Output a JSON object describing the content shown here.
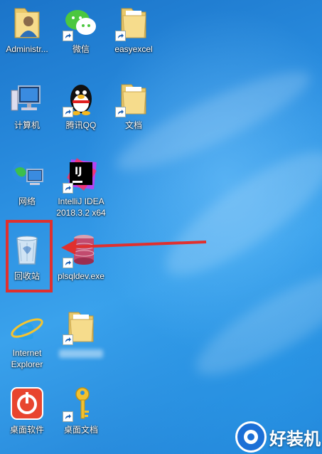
{
  "desktop": {
    "icons": [
      {
        "id": "administrator",
        "label": "Administr...",
        "icon": "user-folder-icon"
      },
      {
        "id": "wechat",
        "label": "微信",
        "icon": "wechat-icon"
      },
      {
        "id": "easyexcel",
        "label": "easyexcel",
        "icon": "folder-icon"
      },
      {
        "id": "computer",
        "label": "计算机",
        "icon": "computer-icon"
      },
      {
        "id": "qq",
        "label": "腾讯QQ",
        "icon": "qq-penguin-icon"
      },
      {
        "id": "documents",
        "label": "文档",
        "icon": "folder-icon"
      },
      {
        "id": "network",
        "label": "网络",
        "icon": "network-icon"
      },
      {
        "id": "intellij",
        "label": "IntelliJ IDEA\n2018.3.2 x64",
        "icon": "intellij-icon"
      },
      {
        "id": "recycle-bin",
        "label": "回收站",
        "icon": "recycle-bin-icon"
      },
      {
        "id": "plsqldev",
        "label": "plsqldev.exe",
        "icon": "plsql-database-icon"
      },
      {
        "id": "ie",
        "label": "Internet\nExplorer",
        "icon": "internet-explorer-icon"
      },
      {
        "id": "desktop-software",
        "label": "桌面软件",
        "icon": "power-app-icon"
      },
      {
        "id": "desktop-docs",
        "label": "桌面文档",
        "icon": "key-icon"
      }
    ],
    "annotation": {
      "highlight_color": "#e0302e"
    },
    "intellij_badge": "IJ"
  },
  "watermark": {
    "text": "好装机"
  }
}
